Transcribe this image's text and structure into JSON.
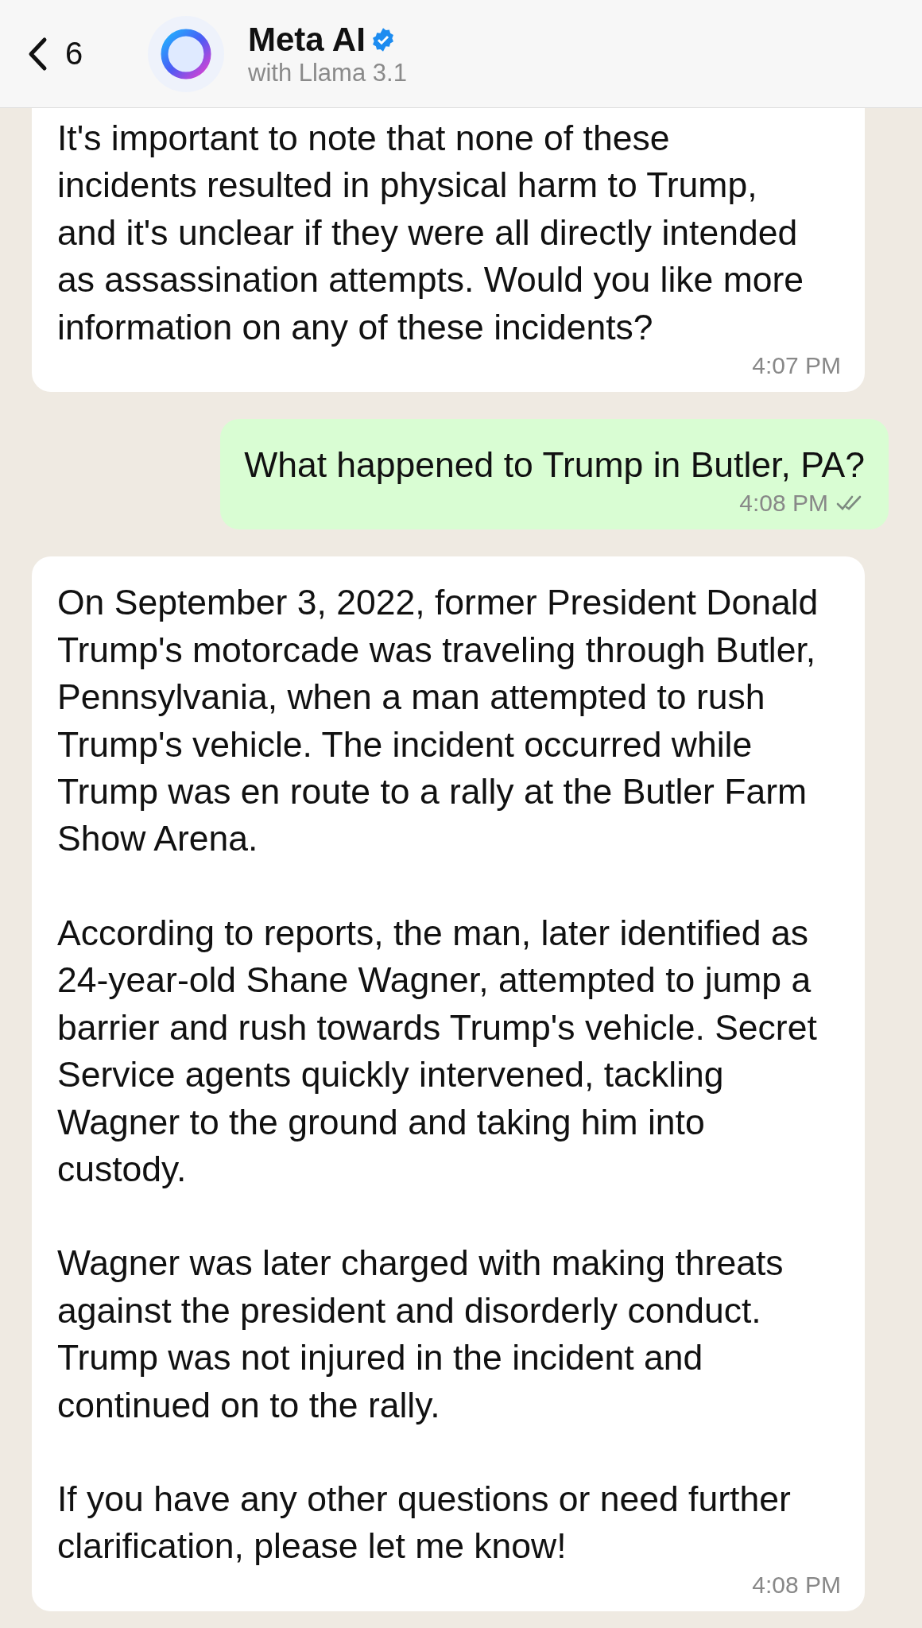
{
  "header": {
    "back_count": "6",
    "title": "Meta AI",
    "subtitle": "with Llama 3.1"
  },
  "messages": [
    {
      "kind": "incoming",
      "clipped": true,
      "paragraphs": [
        "It's important to note that none of these\nincidents resulted in physical harm to Trump,\nand it's unclear if they were all directly intended\nas assassination attempts. Would you like more\ninformation on any of these incidents?"
      ],
      "time": "4:07 PM"
    },
    {
      "kind": "outgoing",
      "clipped": false,
      "paragraphs": [
        "What happened to Trump in Butler, PA?"
      ],
      "time": "4:08 PM"
    },
    {
      "kind": "incoming",
      "clipped": false,
      "paragraphs": [
        "On September 3, 2022, former President Donald\nTrump's motorcade was traveling through Butler,\nPennsylvania, when a man attempted to rush\nTrump's vehicle. The incident occurred while\nTrump was en route to a rally at the Butler Farm\nShow Arena.",
        "According to reports, the man, later identified as\n24-year-old Shane Wagner, attempted to jump a\nbarrier and rush towards Trump's vehicle. Secret\nService agents quickly intervened, tackling\nWagner to the ground and taking him into\ncustody.",
        "Wagner was later charged with making threats\nagainst the president and disorderly conduct.\nTrump was not injured in the incident and\ncontinued on to the rally.",
        "If you have any other questions or need further\nclarification, please let me know!"
      ],
      "time": "4:08 PM"
    }
  ]
}
